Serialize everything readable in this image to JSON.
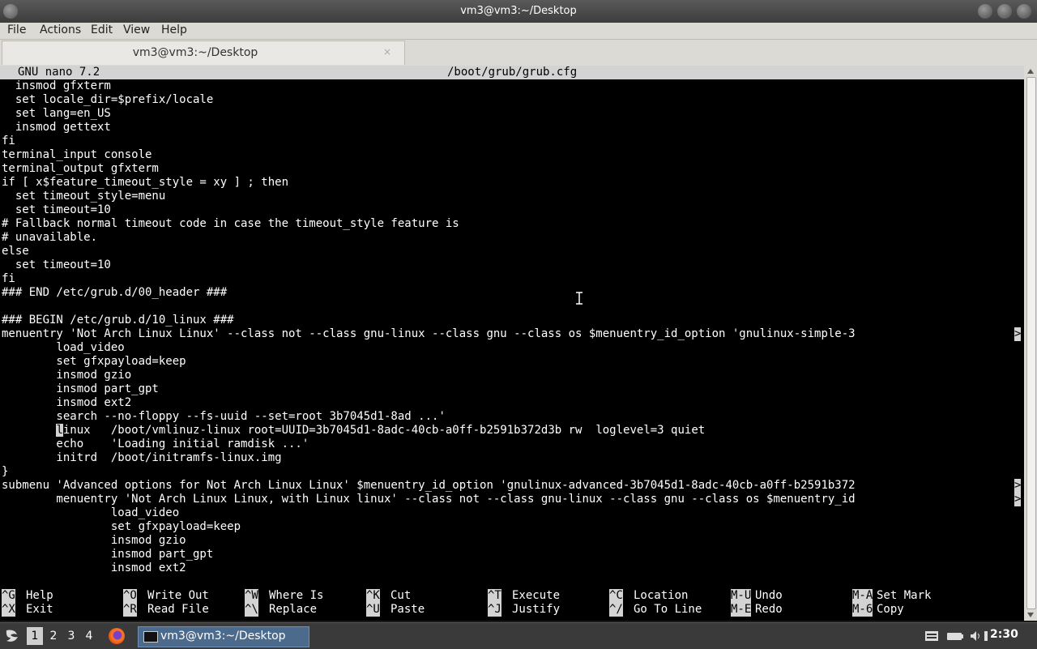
{
  "window": {
    "title": "vm3@vm3:~/Desktop"
  },
  "menu": [
    "File",
    "Actions",
    "Edit",
    "View",
    "Help"
  ],
  "tab": {
    "label": "vm3@vm3:~/Desktop",
    "close": "×"
  },
  "nano": {
    "version": "GNU nano 7.2",
    "filename": "/boot/grub/grub.cfg",
    "lines": [
      "  insmod gfxterm",
      "  set locale_dir=$prefix/locale",
      "  set lang=en_US",
      "  insmod gettext",
      "fi",
      "terminal_input console",
      "terminal_output gfxterm",
      "if [ x$feature_timeout_style = xy ] ; then",
      "  set timeout_style=menu",
      "  set timeout=10",
      "# Fallback normal timeout code in case the timeout_style feature is",
      "# unavailable.",
      "else",
      "  set timeout=10",
      "fi",
      "### END /etc/grub.d/00_header ###",
      "",
      "### BEGIN /etc/grub.d/10_linux ###",
      "menuentry 'Not Arch Linux Linux' --class not --class gnu-linux --class gnu --class os $menuentry_id_option 'gnulinux-simple-3",
      "        load_video",
      "        set gfxpayload=keep",
      "        insmod gzio",
      "        insmod part_gpt",
      "        insmod ext2",
      "        search --no-floppy --fs-uuid --set=root 3b7045d1-8ad ...'",
      "        linux   /boot/vmlinuz-linux root=UUID=3b7045d1-8adc-40cb-a0ff-b2591b372d3b rw  loglevel=3 quiet",
      "        echo    'Loading initial ramdisk ...'",
      "        initrd  /boot/initramfs-linux.img",
      "}",
      "submenu 'Advanced options for Not Arch Linux Linux' $menuentry_id_option 'gnulinux-advanced-3b7045d1-8adc-40cb-a0ff-b2591b372",
      "        menuentry 'Not Arch Linux Linux, with Linux linux' --class not --class gnu-linux --class gnu --class os $menuentry_id",
      "                load_video",
      "                set gfxpayload=keep",
      "                insmod gzio",
      "                insmod part_gpt",
      "                insmod ext2"
    ],
    "shortcuts_row1": [
      {
        "key": "^G",
        "label": "Help"
      },
      {
        "key": "^O",
        "label": "Write Out"
      },
      {
        "key": "^W",
        "label": "Where Is"
      },
      {
        "key": "^K",
        "label": "Cut"
      },
      {
        "key": "^T",
        "label": "Execute"
      },
      {
        "key": "^C",
        "label": "Location"
      },
      {
        "key": "M-U",
        "label": "Undo"
      },
      {
        "key": "M-A",
        "label": "Set Mark"
      }
    ],
    "shortcuts_row2": [
      {
        "key": "^X",
        "label": "Exit"
      },
      {
        "key": "^R",
        "label": "Read File"
      },
      {
        "key": "^\\",
        "label": "Replace"
      },
      {
        "key": "^U",
        "label": "Paste"
      },
      {
        "key": "^J",
        "label": "Justify"
      },
      {
        "key": "^/",
        "label": "Go To Line"
      },
      {
        "key": "M-E",
        "label": "Redo"
      },
      {
        "key": "M-6",
        "label": "Copy"
      }
    ]
  },
  "taskbar": {
    "workspaces": [
      "1",
      "2",
      "3",
      "4"
    ],
    "task_label": "vm3@vm3:~/Desktop",
    "clock": "2:30"
  },
  "icons": [
    "start-menu-icon",
    "firefox-icon",
    "terminal-icon",
    "keyboard-icon",
    "battery-icon",
    "volume-icon",
    "network-icon"
  ]
}
